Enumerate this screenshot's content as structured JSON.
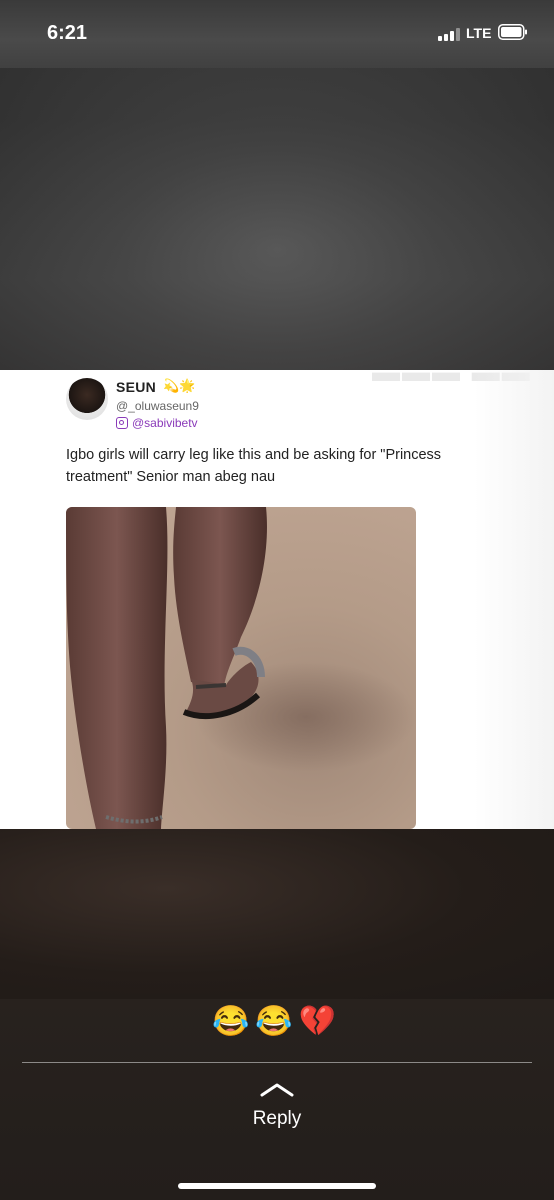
{
  "status_bar": {
    "time": "6:21",
    "network": "LTE",
    "signal_icon": "signal-bars-icon",
    "battery_icon": "battery-icon"
  },
  "post": {
    "author_name": "SEUN",
    "author_badge": "💫🌟",
    "handle": "@_oluwaseun9",
    "instagram_handle": "@sabivibetv",
    "caption": "Igbo girls will carry leg like this and be asking for \"Princess treatment\" Senior man abeg nau",
    "photo": "legs-walking-photo"
  },
  "reactions": [
    "😂",
    "😂",
    "💔"
  ],
  "reply": {
    "label": "Reply",
    "icon": "chevron-up-icon"
  },
  "colors": {
    "ig_accent": "#8a3ab9",
    "text_white": "#ffffff",
    "divider": "#8c8a88"
  }
}
